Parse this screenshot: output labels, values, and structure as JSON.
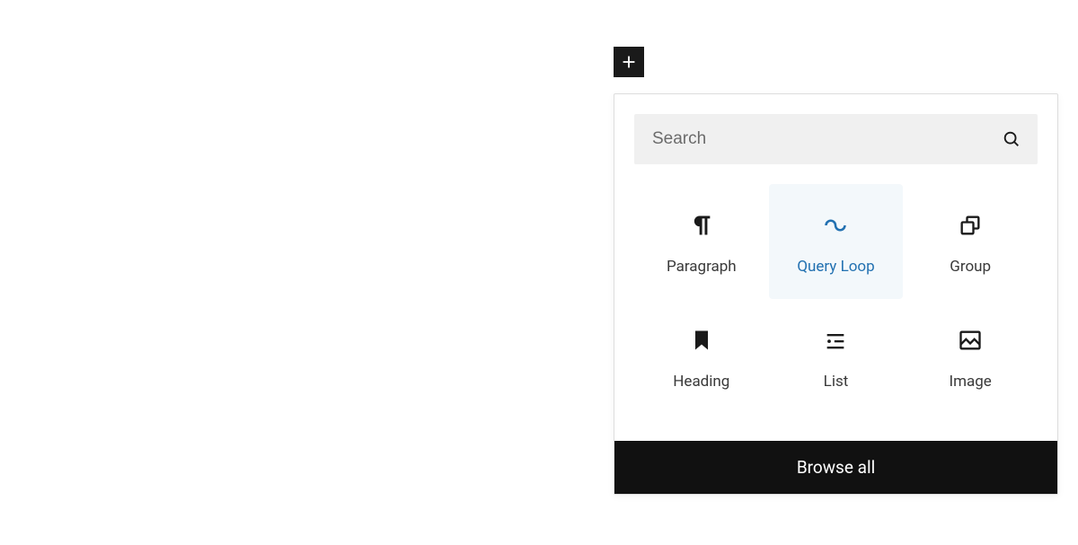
{
  "inserter": {
    "search_placeholder": "Search",
    "browse_all_label": "Browse all",
    "blocks": [
      {
        "label": "Paragraph",
        "icon": "pilcrow",
        "highlighted": false
      },
      {
        "label": "Query Loop",
        "icon": "loop",
        "highlighted": true
      },
      {
        "label": "Group",
        "icon": "group",
        "highlighted": false
      },
      {
        "label": "Heading",
        "icon": "bookmark",
        "highlighted": false
      },
      {
        "label": "List",
        "icon": "list",
        "highlighted": false
      },
      {
        "label": "Image",
        "icon": "image",
        "highlighted": false
      }
    ]
  }
}
